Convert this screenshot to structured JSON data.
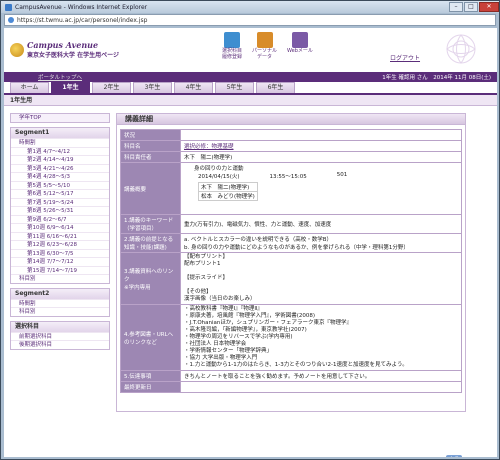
{
  "window": {
    "title": "CampusAvenue - Windows Internet Explorer",
    "url": "https://st.twmu.ac.jp/car/personel/index.jsp"
  },
  "header": {
    "logo_title": "Campus Avenue",
    "logo_sub": "東京女子医科大学 在学生用ページ",
    "icons": [
      {
        "icon": "book-icon",
        "label": "選択科目\n履修登録",
        "color": "#3e8ed0"
      },
      {
        "icon": "data-icon",
        "label": "パーソナル\nデータ",
        "color": "#d88c2a"
      },
      {
        "icon": "web-mail-icon",
        "label": "Webメール",
        "color": "#7b5aa6"
      }
    ],
    "logout": "ログアウト"
  },
  "userbar": {
    "portal": "ポータルトップへ",
    "user": "1年生  確認用 さん　2014年 11月 08日(土)"
  },
  "tabs": [
    "ホーム",
    "1年生",
    "2年生",
    "3年生",
    "4年生",
    "5年生",
    "6年生"
  ],
  "active_tab": 1,
  "year_title": "1年生用",
  "sidebar": {
    "top": "学年TOP",
    "seg1": {
      "title": "Segment1",
      "timetable": "時間割",
      "weeks": [
        "第1週 4/7〜4/12",
        "第2週 4/14〜4/19",
        "第3週 4/21〜4/26",
        "第4週 4/28〜5/3",
        "第5週 5/5〜5/10",
        "第6週 5/12〜5/17",
        "第7週 5/19〜5/24",
        "第8週 5/26〜5/31",
        "第9週 6/2〜6/7",
        "第10週 6/9〜6/14",
        "第11週 6/16〜6/21",
        "第12週 6/23〜6/28",
        "第13週 6/30〜7/5",
        "第14週 7/7〜7/12",
        "第15週 7/14〜7/19"
      ],
      "subject": "科目別"
    },
    "seg2": {
      "title": "Segment2",
      "timetable": "時間割",
      "subject": "科目別"
    },
    "elective": {
      "title": "選択科目",
      "first": "前期選択科目",
      "second": "後期選択科目"
    }
  },
  "main": {
    "title": "講義詳細",
    "rows": {
      "status": "状況",
      "subject_label": "科目名",
      "subject_value": "選択必修：物理基礎",
      "teacher_label": "科目責任者",
      "teacher_value": "木下　陽二(物理学)",
      "summary_label": "講義概要",
      "summary_title": "身の回りの力と運動",
      "summary_date": "2014/04/15(火)",
      "summary_time": "13:55〜15:05",
      "summary_room": "501",
      "summary_people": [
        "木下　陽二(物理学)",
        "松本　みどり(物理学)"
      ],
      "keyword_label": "1.講義のキーワード（学習項目）",
      "keyword_value": "重力(万有引力)、電磁気力、慣性、力と運動、速度、加速度",
      "goal_label": "2.講義の前提となる知識・技能(課題)",
      "goal_value": "a. ベクトルとスカラーの違いを説明できる（高校・数学B）\nb. 身の回りの力や運動にどのようなものがあるか、例を挙げられる（中学・理科第1分野）",
      "material_label": "3.講義資料へのリンク\n※学内専用",
      "material_value": "【配布プリント】\n配布プリント1\n\n【提示スライド】\n\n【その他】\n漢字画像（当日のお楽しみ）",
      "ref_label": "4.参考図書・URLへのリンクなど",
      "ref_value": "・高校教科書『物理Ⅰ』『物理Ⅱ』\n・原康夫著，培風館『物理学入門』，学術図書(2008)\n・J.T.Ohanianほか，シュプリンガー・フェアラーク東京『物理学』\n・高木隆司編，『新編物理学』，東京教学社(2007)\n・物理学の周辺をリバースで学ぶ(学内専用)\n・社団法人 日本物理学会\n・学術情報センター「物理学辞典」\n・協力 大学出版・物理学入門\n・1.力と運動から1-1力のはたらき、1-3力とそのつり合い2-1速度と加速度を見てみよう。",
      "notice_label": "5.伝達事項",
      "notice_value": "きちんとノートを取ることを強く勧めます。予めノートを用意して下さい。",
      "updated_label": "最終更新日",
      "updated_value": ""
    },
    "back": "戻る"
  }
}
